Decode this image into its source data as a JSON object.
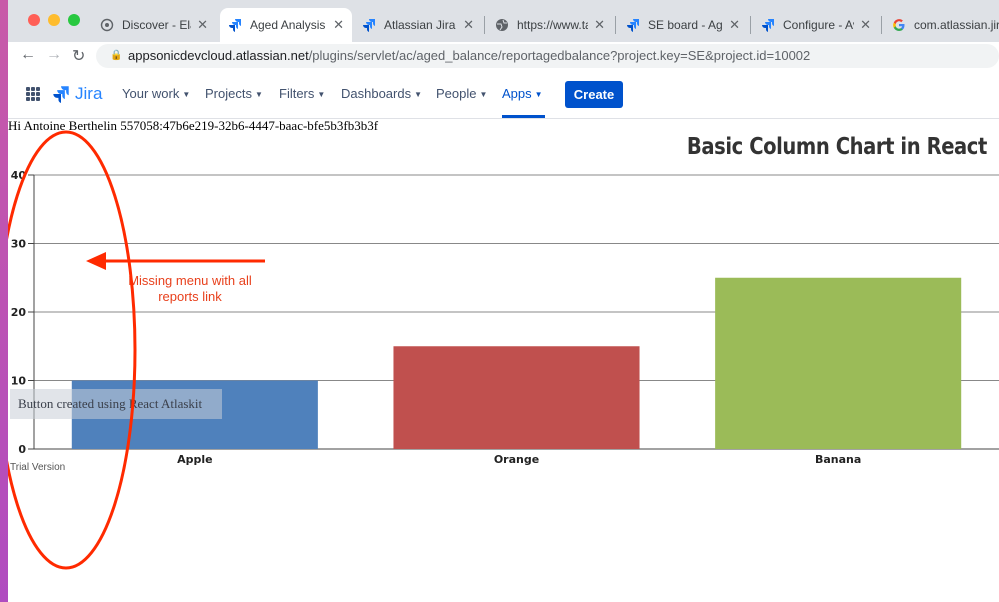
{
  "browser": {
    "tabs": [
      {
        "label": "Discover - Elast",
        "icon": "elastic-icon",
        "active": false
      },
      {
        "label": "Aged Analysis R",
        "icon": "jira-icon",
        "active": true
      },
      {
        "label": "Atlassian Jira an",
        "icon": "jira-icon",
        "active": false
      },
      {
        "label": "https://www.tab",
        "icon": "globe-icon",
        "active": false
      },
      {
        "label": "SE board - Agile",
        "icon": "jira-icon",
        "active": false
      },
      {
        "label": "Configure - Ave",
        "icon": "jira-icon",
        "active": false
      },
      {
        "label": "com.atlassian.jir",
        "icon": "google-icon",
        "active": false
      }
    ],
    "url_host": "appsonicdevcloud.atlassian.net",
    "url_path": "/plugins/servlet/ac/aged_balance/reportagedbalance?project.key=SE&project.id=10002"
  },
  "jira": {
    "logo_text": "Jira",
    "nav": [
      {
        "label": "Your work"
      },
      {
        "label": "Projects"
      },
      {
        "label": "Filters"
      },
      {
        "label": "Dashboards"
      },
      {
        "label": "People"
      },
      {
        "label": "Apps",
        "active": true
      }
    ],
    "create_label": "Create"
  },
  "content": {
    "greeting": "Hi Antoine Berthelin 557058:47b6e219-32b6-4447-baac-bfe5b3fb3b3f",
    "button_label": "Button created using React Atlaskit",
    "trial_text": "Trial Version",
    "annotation": "Missing menu with all reports link"
  },
  "chart_data": {
    "type": "bar",
    "title": "Basic Column Chart in React",
    "categories": [
      "Apple",
      "Orange",
      "Banana"
    ],
    "values": [
      10,
      15,
      25
    ],
    "colors": [
      "#4f81bc",
      "#c0504e",
      "#9bbb58"
    ],
    "ylim": [
      0,
      40
    ],
    "yticks": [
      0,
      10,
      20,
      30,
      40
    ],
    "grid": true
  },
  "colors": {
    "jira_blue": "#0052cc",
    "annotation_red": "#ff2a00"
  }
}
